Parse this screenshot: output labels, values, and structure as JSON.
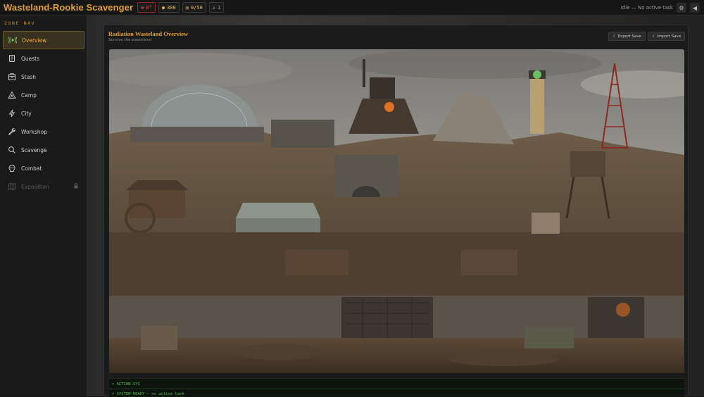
{
  "app": {
    "title": "Wasteland-Rookie Scavenger",
    "chips": [
      {
        "icon": "radiation-icon",
        "glyph": "☢",
        "text": "0°"
      },
      {
        "icon": "coin-icon",
        "glyph": "●",
        "text": "300"
      },
      {
        "icon": "backpack-icon",
        "glyph": "▣",
        "text": "0/50"
      },
      {
        "icon": "person-icon",
        "glyph": "♙",
        "text": "1"
      }
    ],
    "status": "Idle — No active task"
  },
  "sidebar": {
    "heading": "ZONE NAV",
    "items": [
      {
        "label": "Overview",
        "icon": "radar-icon",
        "active": true
      },
      {
        "label": "Quests",
        "icon": "scroll-icon"
      },
      {
        "label": "Stash",
        "icon": "box-icon"
      },
      {
        "label": "Camp",
        "icon": "tent-icon"
      },
      {
        "label": "City",
        "icon": "lightning-icon"
      },
      {
        "label": "Workshop",
        "icon": "wrench-icon"
      },
      {
        "label": "Scavenge",
        "icon": "magnifier-icon"
      },
      {
        "label": "Combat",
        "icon": "skull-icon"
      },
      {
        "label": "Expedition",
        "icon": "map-icon",
        "disabled": true
      }
    ]
  },
  "panel": {
    "title": "Radiation Wasteland Overview",
    "subtitle": "Survive the wasteland",
    "export_label": "Export Save",
    "import_label": "Import Save"
  },
  "console": {
    "line1": "> ACTION.SYS",
    "line2": "> SYSTEM READY — no active task"
  },
  "colors": {
    "accent": "#e0a030",
    "console_text": "#4fc04f",
    "danger": "#e05050"
  }
}
